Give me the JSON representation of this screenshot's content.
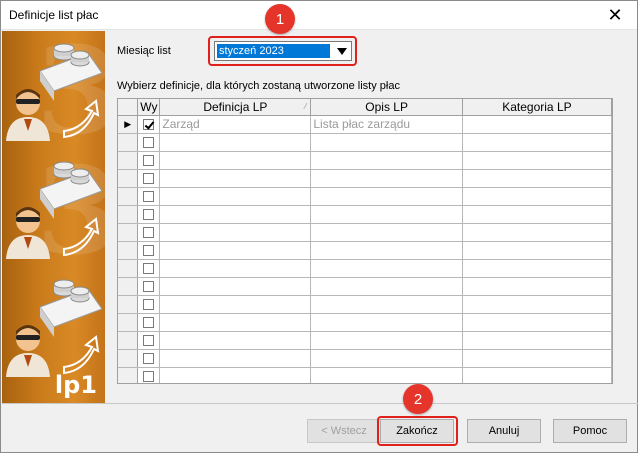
{
  "window": {
    "title": "Definicje list płac",
    "close_symbol": "✕"
  },
  "side_panel": {
    "label": "lp1"
  },
  "month": {
    "label": "Miesiąc list",
    "selected": "styczeń 2023"
  },
  "instructions": "Wybierz definicje, dla których zostaną utworzone listy płac",
  "grid": {
    "columns": [
      "Wy",
      "Definicja LP",
      "Opis LP",
      "Kategoria LP"
    ],
    "rows": [
      {
        "checked": true,
        "definicja": "Zarząd",
        "opis": "Lista płac zarządu",
        "kategoria": ""
      }
    ],
    "empty_row_count": 15,
    "current_row_marker": "▶"
  },
  "buttons": {
    "back": "< Wstecz",
    "finish": "Zakończ",
    "cancel": "Anuluj",
    "help": "Pomoc"
  },
  "annotations": [
    {
      "number": "1",
      "color": "#e5352b"
    },
    {
      "number": "2",
      "color": "#e5352b"
    }
  ]
}
